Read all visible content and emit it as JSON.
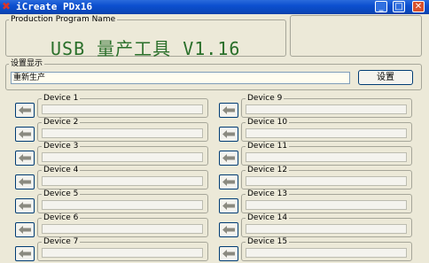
{
  "window": {
    "title": "iCreate PDx16"
  },
  "production_program": {
    "legend": "Production Program Name",
    "title": "USB 量产工具 V1.16"
  },
  "settings": {
    "legend": "设置显示",
    "value": "重新生产",
    "button": "设置"
  },
  "devices_left": [
    "Device 1",
    "Device 2",
    "Device 3",
    "Device 4",
    "Device 5",
    "Device 6",
    "Device 7"
  ],
  "devices_right": [
    "Device 9",
    "Device 10",
    "Device 11",
    "Device 12",
    "Device 13",
    "Device 14",
    "Device 15"
  ]
}
